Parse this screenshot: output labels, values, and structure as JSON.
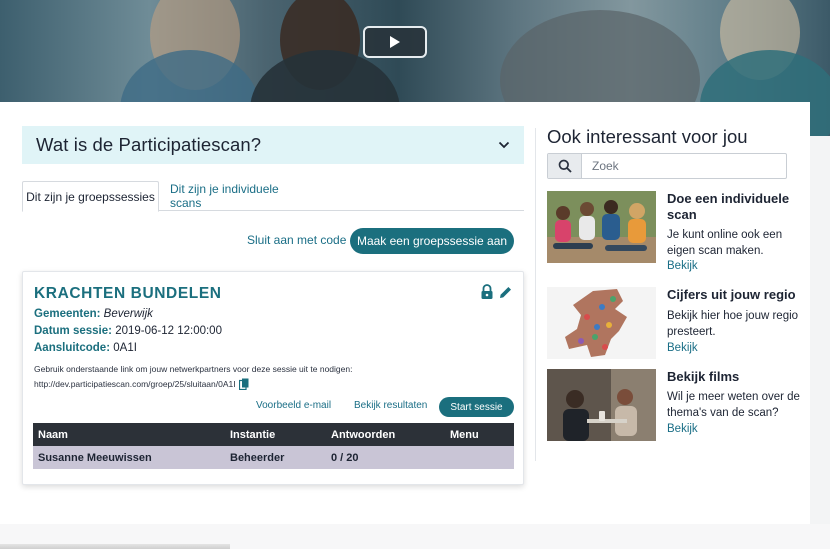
{
  "accordion": {
    "title": "Wat is de Participatiescan?"
  },
  "tabs": [
    {
      "label": "Dit zijn je groepssessies",
      "active": true
    },
    {
      "label": "Dit zijn je individuele scans",
      "active": false
    }
  ],
  "actions": {
    "join_label": "Sluit aan met code",
    "create_label": "Maak een groepssessie aan"
  },
  "session": {
    "title": "KRACHTEN BUNDELEN",
    "gemeenten_label": "Gemeenten:",
    "gemeenten_value": "Beverwijk",
    "datum_label": "Datum sessie:",
    "datum_value": "2019-06-12 12:00:00",
    "code_label": "Aansluitcode:",
    "code_value": "0A1I",
    "hint": "Gebruik onderstaande link om jouw netwerkpartners voor deze sessie uit te nodigen:",
    "url": "http://dev.participatiescan.com/groep/25/sluitaan/0A1I",
    "example_email": "Voorbeeld e-mail",
    "view_results": "Bekijk resultaten",
    "start_label": "Start sessie",
    "columns": [
      "Naam",
      "Instantie",
      "Antwoorden",
      "Menu"
    ],
    "rows": [
      {
        "naam": "Susanne Meeuwissen",
        "instantie": "Beheerder",
        "antwoorden": "0 / 20",
        "menu": ""
      }
    ]
  },
  "sidebar": {
    "title": "Ook interessant voor jou",
    "search_placeholder": "Zoek",
    "promos": [
      {
        "title": "Doe een individuele scan",
        "text": "Je kunt online ook een eigen scan maken.",
        "link": "Bekijk"
      },
      {
        "title": "Cijfers uit jouw regio",
        "text": "Bekijk hier hoe jouw regio presteert.",
        "link": "Bekijk"
      },
      {
        "title": "Bekijk films",
        "text": "Wil je meer weten over de thema's van de scan?",
        "link": "Bekijk"
      }
    ]
  },
  "colors": {
    "accent": "#1b6f7e",
    "link": "#1a6e86",
    "accordion_bg": "#e0f4f7",
    "table_head": "#2c3138",
    "table_row": "#c9c5d6"
  },
  "icons": [
    "play-icon",
    "chevron-down-icon",
    "lock-icon",
    "pencil-icon",
    "copy-icon",
    "search-icon"
  ]
}
